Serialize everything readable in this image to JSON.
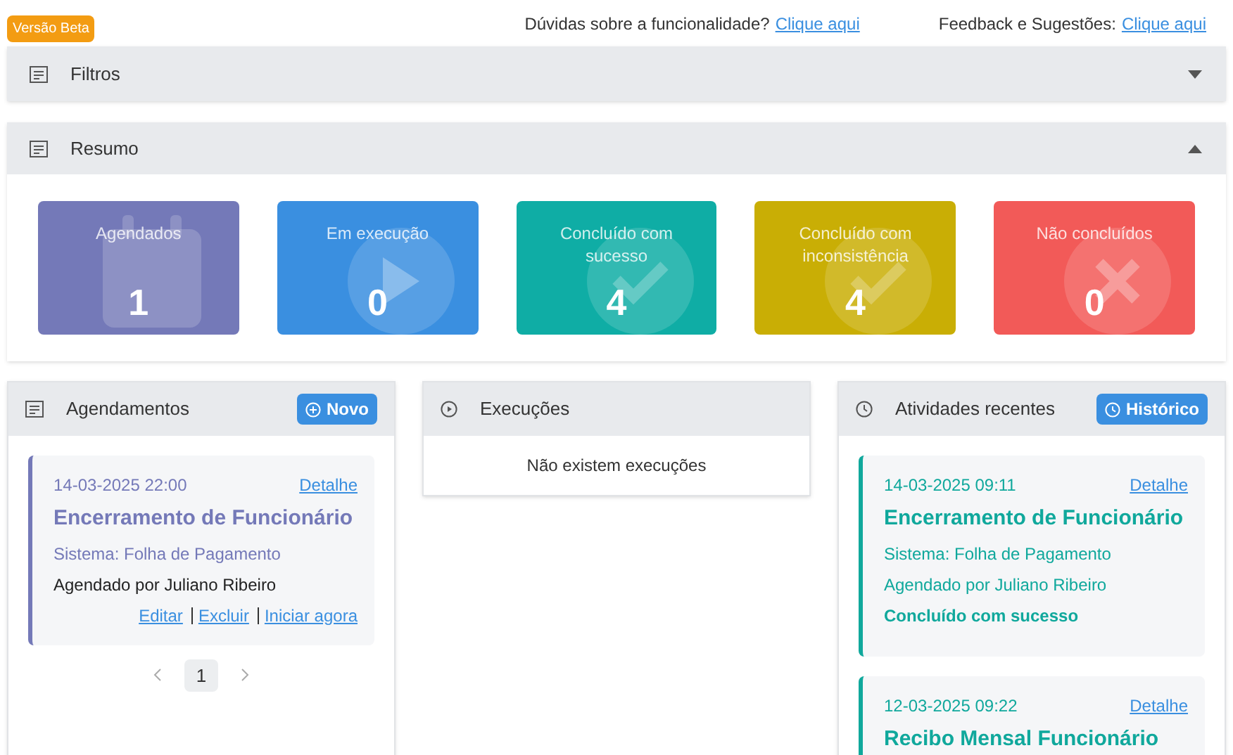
{
  "beta_badge": "Versão Beta",
  "help_links": [
    {
      "label": "Dúvidas sobre a funcionalidade?",
      "link": "Clique aqui"
    },
    {
      "label": "Feedback e Sugestões:",
      "link": "Clique aqui"
    }
  ],
  "filters": {
    "title": "Filtros",
    "expanded": false
  },
  "summary": {
    "title": "Resumo",
    "expanded": true,
    "cards": [
      {
        "label": "Agendados",
        "count": "1",
        "kind": "calendar",
        "color": "#7479b8"
      },
      {
        "label": "Em execução",
        "count": "0",
        "kind": "play",
        "color": "#3a8fe0"
      },
      {
        "label": "Concluído com sucesso",
        "count": "4",
        "kind": "check",
        "color": "#0fada5"
      },
      {
        "label": "Concluído com inconsistência",
        "count": "4",
        "kind": "check",
        "color": "#c9ae05"
      },
      {
        "label": "Não concluídos",
        "count": "0",
        "kind": "cross",
        "color": "#f25a58"
      }
    ]
  },
  "schedules": {
    "title": "Agendamentos",
    "button": "Novo",
    "items": [
      {
        "datetime": "14-03-2025 22:00",
        "detail": "Detalhe",
        "title": "Encerramento de Funcionário",
        "system": "Sistema: Folha de Pagamento",
        "by": "Agendado por Juliano Ribeiro",
        "actions": [
          "Editar",
          "Excluir",
          "Iniciar agora"
        ],
        "color": "#7479b8"
      }
    ],
    "pages": [
      {
        "label": "1",
        "selected": true
      }
    ]
  },
  "executions": {
    "title": "Execuções",
    "empty": "Não existem execuções"
  },
  "activities": {
    "title": "Atividades recentes",
    "button": "Histórico",
    "items": [
      {
        "datetime": "14-03-2025 09:11",
        "detail": "Detalhe",
        "title": "Encerramento de Funcionário",
        "system": "Sistema: Folha de Pagamento",
        "by": "Agendado por Juliano Ribeiro",
        "status": "Concluído com sucesso",
        "color": "#10a89c"
      },
      {
        "datetime": "12-03-2025 09:22",
        "detail": "Detalhe",
        "title": "Recibo Mensal Funcionário",
        "color": "#10a89c"
      }
    ]
  }
}
